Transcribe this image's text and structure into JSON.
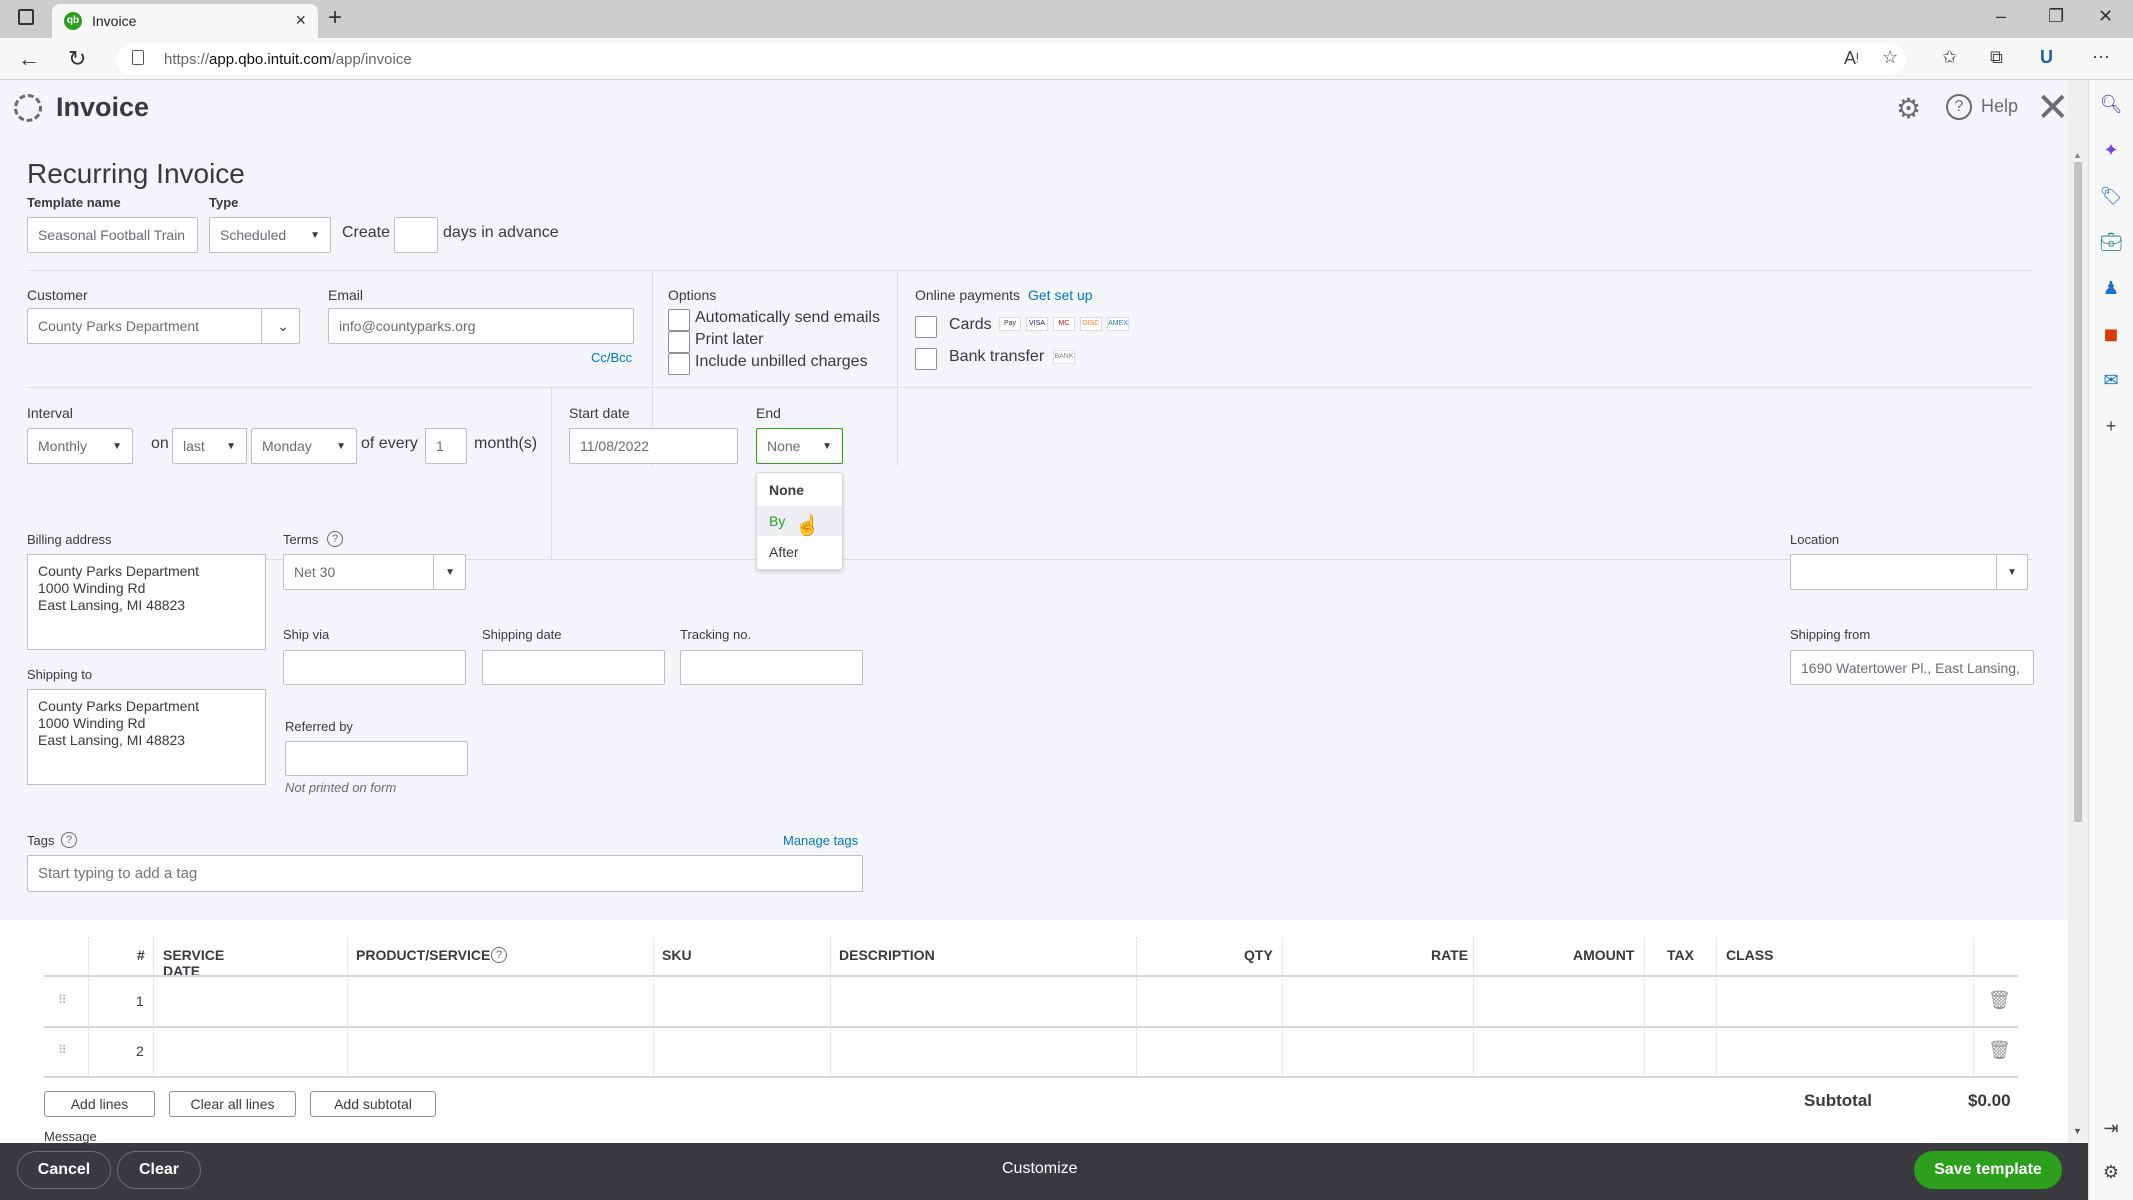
{
  "browser": {
    "tab_title": "Invoice",
    "tab_favicon": "qb",
    "url_prefix": "https://",
    "url_host": "app.qbo.intuit.com",
    "url_path": "/app/invoice",
    "icons": [
      "sidebar-toggle-icon",
      "back-icon",
      "refresh-icon",
      "lock-icon",
      "read-aloud-icon",
      "add-favorite-icon",
      "favorites-icon",
      "collections-icon",
      "profile-icon",
      "more-icon",
      "minimize-icon",
      "restore-icon",
      "close-window-icon"
    ],
    "side_icons": [
      "search-icon",
      "copilot-icon",
      "shopping-icon",
      "tools-icon",
      "games-icon",
      "office-icon",
      "outlook-icon",
      "add-icon",
      "split-screen-icon",
      "settings-icon"
    ]
  },
  "header": {
    "title": "Invoice",
    "help": "Help"
  },
  "form": {
    "title": "Recurring Invoice",
    "template_name": {
      "label": "Template name",
      "value": "Seasonal Football Train"
    },
    "type": {
      "label": "Type",
      "value": "Scheduled"
    },
    "create_label": "Create",
    "create_days": "",
    "days_suffix": "days in advance",
    "customer": {
      "label": "Customer",
      "value": "County Parks Department"
    },
    "email": {
      "label": "Email",
      "value": "info@countyparks.org",
      "ccbcc": "Cc/Bcc"
    },
    "options": {
      "label": "Options",
      "items": [
        "Automatically send emails",
        "Print later",
        "Include unbilled charges"
      ]
    },
    "online_payments": {
      "label": "Online payments",
      "link": "Get set up",
      "cards": "Cards",
      "bank": "Bank transfer",
      "card_brands": [
        "Pay",
        "VISA",
        "MC",
        "DISC",
        "AMEX"
      ],
      "bank_badge": "BANK"
    },
    "interval": {
      "label": "Interval",
      "value": "Monthly",
      "on": "on",
      "week": "last",
      "day": "Monday",
      "of_every": "of every",
      "every": "1",
      "unit": "month(s)"
    },
    "start_date": {
      "label": "Start date",
      "value": "11/08/2022"
    },
    "end": {
      "label": "End",
      "value": "None",
      "options": [
        "None",
        "By",
        "After"
      ],
      "hovered": "By"
    },
    "billing": {
      "label": "Billing address",
      "lines": [
        "County Parks Department",
        "1000 Winding Rd",
        "East Lansing, MI  48823"
      ]
    },
    "shipping_to": {
      "label": "Shipping to",
      "lines": [
        "County Parks Department",
        "1000 Winding Rd",
        "East Lansing, MI  48823"
      ]
    },
    "terms": {
      "label": "Terms",
      "value": "Net 30"
    },
    "ship_via": {
      "label": "Ship via",
      "value": ""
    },
    "shipping_date": {
      "label": "Shipping date",
      "value": ""
    },
    "tracking": {
      "label": "Tracking no.",
      "value": ""
    },
    "referred_by": {
      "label": "Referred by",
      "value": "",
      "note": "Not printed on form"
    },
    "location": {
      "label": "Location",
      "value": ""
    },
    "shipping_from": {
      "label": "Shipping from",
      "value": "1690 Watertower Pl., East Lansing,"
    },
    "tags": {
      "label": "Tags",
      "manage": "Manage tags",
      "placeholder": "Start typing to add a tag"
    }
  },
  "table": {
    "columns": [
      "#",
      "SERVICE DATE",
      "PRODUCT/SERVICE",
      "SKU",
      "DESCRIPTION",
      "QTY",
      "RATE",
      "AMOUNT",
      "TAX",
      "CLASS"
    ],
    "rows": [
      {
        "num": "1"
      },
      {
        "num": "2"
      }
    ],
    "buttons": {
      "add_lines": "Add lines",
      "clear_all": "Clear all lines",
      "add_subtotal": "Add subtotal"
    },
    "subtotal_label": "Subtotal",
    "subtotal_value": "$0.00",
    "message_label": "Message on invoice"
  },
  "footer": {
    "cancel": "Cancel",
    "clear": "Clear",
    "customize": "Customize",
    "save": "Save template"
  },
  "colors": {
    "accent": "#2ca01c",
    "link": "#0077c5",
    "footer": "#393a3d"
  }
}
